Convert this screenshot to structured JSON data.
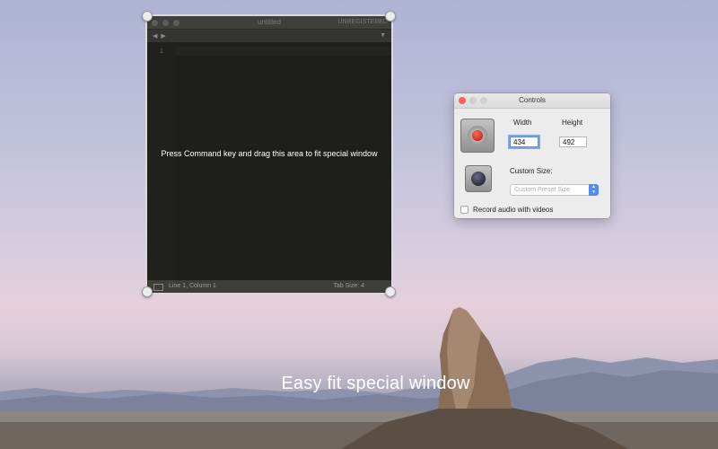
{
  "caption": "Easy fit special window",
  "editor": {
    "title": "untitled",
    "registration": "UNREGISTERED",
    "nav_arrows": "◀ ▶",
    "dropdown_arrow": "▼",
    "line_number": "1",
    "message": "Press Command key and drag this area to fit special window",
    "status_left": "Line 1, Column 1",
    "status_right": "Tab Size: 4"
  },
  "controls": {
    "title": "Controls",
    "width_label": "Width",
    "height_label": "Height",
    "width_value": "434",
    "height_value": "492",
    "custom_size_label": "Custom Size:",
    "preset_placeholder": "Custom Preset Size",
    "record_audio_label": "Record audio with videos",
    "record_audio_checked": false
  },
  "colors": {
    "close": "#ff5f57",
    "inactive": "#cfcfcf",
    "select_accent": "#4f8ef7",
    "editor_bg": "#1e1e1b"
  }
}
